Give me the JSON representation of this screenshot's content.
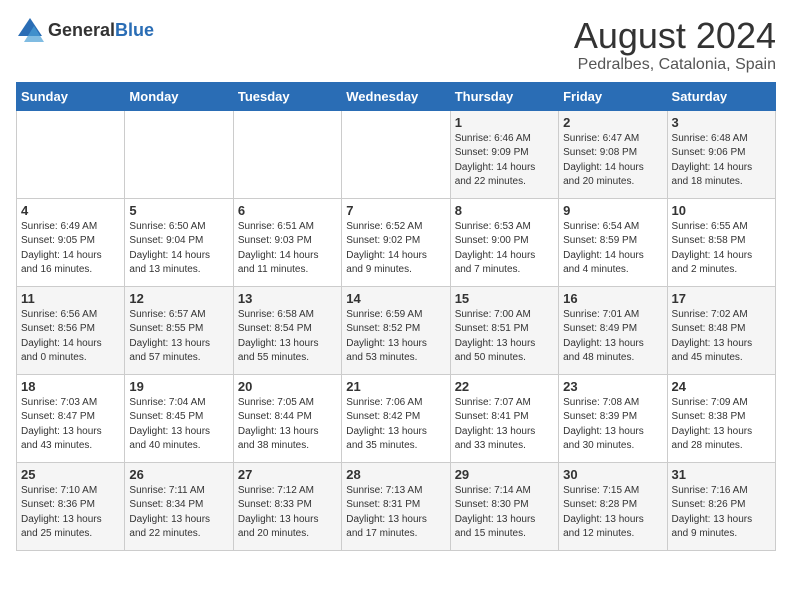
{
  "logo": {
    "text_general": "General",
    "text_blue": "Blue"
  },
  "title": "August 2024",
  "subtitle": "Pedralbes, Catalonia, Spain",
  "days_of_week": [
    "Sunday",
    "Monday",
    "Tuesday",
    "Wednesday",
    "Thursday",
    "Friday",
    "Saturday"
  ],
  "weeks": [
    [
      {
        "day": "",
        "info": ""
      },
      {
        "day": "",
        "info": ""
      },
      {
        "day": "",
        "info": ""
      },
      {
        "day": "",
        "info": ""
      },
      {
        "day": "1",
        "info": "Sunrise: 6:46 AM\nSunset: 9:09 PM\nDaylight: 14 hours\nand 22 minutes."
      },
      {
        "day": "2",
        "info": "Sunrise: 6:47 AM\nSunset: 9:08 PM\nDaylight: 14 hours\nand 20 minutes."
      },
      {
        "day": "3",
        "info": "Sunrise: 6:48 AM\nSunset: 9:06 PM\nDaylight: 14 hours\nand 18 minutes."
      }
    ],
    [
      {
        "day": "4",
        "info": "Sunrise: 6:49 AM\nSunset: 9:05 PM\nDaylight: 14 hours\nand 16 minutes."
      },
      {
        "day": "5",
        "info": "Sunrise: 6:50 AM\nSunset: 9:04 PM\nDaylight: 14 hours\nand 13 minutes."
      },
      {
        "day": "6",
        "info": "Sunrise: 6:51 AM\nSunset: 9:03 PM\nDaylight: 14 hours\nand 11 minutes."
      },
      {
        "day": "7",
        "info": "Sunrise: 6:52 AM\nSunset: 9:02 PM\nDaylight: 14 hours\nand 9 minutes."
      },
      {
        "day": "8",
        "info": "Sunrise: 6:53 AM\nSunset: 9:00 PM\nDaylight: 14 hours\nand 7 minutes."
      },
      {
        "day": "9",
        "info": "Sunrise: 6:54 AM\nSunset: 8:59 PM\nDaylight: 14 hours\nand 4 minutes."
      },
      {
        "day": "10",
        "info": "Sunrise: 6:55 AM\nSunset: 8:58 PM\nDaylight: 14 hours\nand 2 minutes."
      }
    ],
    [
      {
        "day": "11",
        "info": "Sunrise: 6:56 AM\nSunset: 8:56 PM\nDaylight: 14 hours\nand 0 minutes."
      },
      {
        "day": "12",
        "info": "Sunrise: 6:57 AM\nSunset: 8:55 PM\nDaylight: 13 hours\nand 57 minutes."
      },
      {
        "day": "13",
        "info": "Sunrise: 6:58 AM\nSunset: 8:54 PM\nDaylight: 13 hours\nand 55 minutes."
      },
      {
        "day": "14",
        "info": "Sunrise: 6:59 AM\nSunset: 8:52 PM\nDaylight: 13 hours\nand 53 minutes."
      },
      {
        "day": "15",
        "info": "Sunrise: 7:00 AM\nSunset: 8:51 PM\nDaylight: 13 hours\nand 50 minutes."
      },
      {
        "day": "16",
        "info": "Sunrise: 7:01 AM\nSunset: 8:49 PM\nDaylight: 13 hours\nand 48 minutes."
      },
      {
        "day": "17",
        "info": "Sunrise: 7:02 AM\nSunset: 8:48 PM\nDaylight: 13 hours\nand 45 minutes."
      }
    ],
    [
      {
        "day": "18",
        "info": "Sunrise: 7:03 AM\nSunset: 8:47 PM\nDaylight: 13 hours\nand 43 minutes."
      },
      {
        "day": "19",
        "info": "Sunrise: 7:04 AM\nSunset: 8:45 PM\nDaylight: 13 hours\nand 40 minutes."
      },
      {
        "day": "20",
        "info": "Sunrise: 7:05 AM\nSunset: 8:44 PM\nDaylight: 13 hours\nand 38 minutes."
      },
      {
        "day": "21",
        "info": "Sunrise: 7:06 AM\nSunset: 8:42 PM\nDaylight: 13 hours\nand 35 minutes."
      },
      {
        "day": "22",
        "info": "Sunrise: 7:07 AM\nSunset: 8:41 PM\nDaylight: 13 hours\nand 33 minutes."
      },
      {
        "day": "23",
        "info": "Sunrise: 7:08 AM\nSunset: 8:39 PM\nDaylight: 13 hours\nand 30 minutes."
      },
      {
        "day": "24",
        "info": "Sunrise: 7:09 AM\nSunset: 8:38 PM\nDaylight: 13 hours\nand 28 minutes."
      }
    ],
    [
      {
        "day": "25",
        "info": "Sunrise: 7:10 AM\nSunset: 8:36 PM\nDaylight: 13 hours\nand 25 minutes."
      },
      {
        "day": "26",
        "info": "Sunrise: 7:11 AM\nSunset: 8:34 PM\nDaylight: 13 hours\nand 22 minutes."
      },
      {
        "day": "27",
        "info": "Sunrise: 7:12 AM\nSunset: 8:33 PM\nDaylight: 13 hours\nand 20 minutes."
      },
      {
        "day": "28",
        "info": "Sunrise: 7:13 AM\nSunset: 8:31 PM\nDaylight: 13 hours\nand 17 minutes."
      },
      {
        "day": "29",
        "info": "Sunrise: 7:14 AM\nSunset: 8:30 PM\nDaylight: 13 hours\nand 15 minutes."
      },
      {
        "day": "30",
        "info": "Sunrise: 7:15 AM\nSunset: 8:28 PM\nDaylight: 13 hours\nand 12 minutes."
      },
      {
        "day": "31",
        "info": "Sunrise: 7:16 AM\nSunset: 8:26 PM\nDaylight: 13 hours\nand 9 minutes."
      }
    ]
  ]
}
